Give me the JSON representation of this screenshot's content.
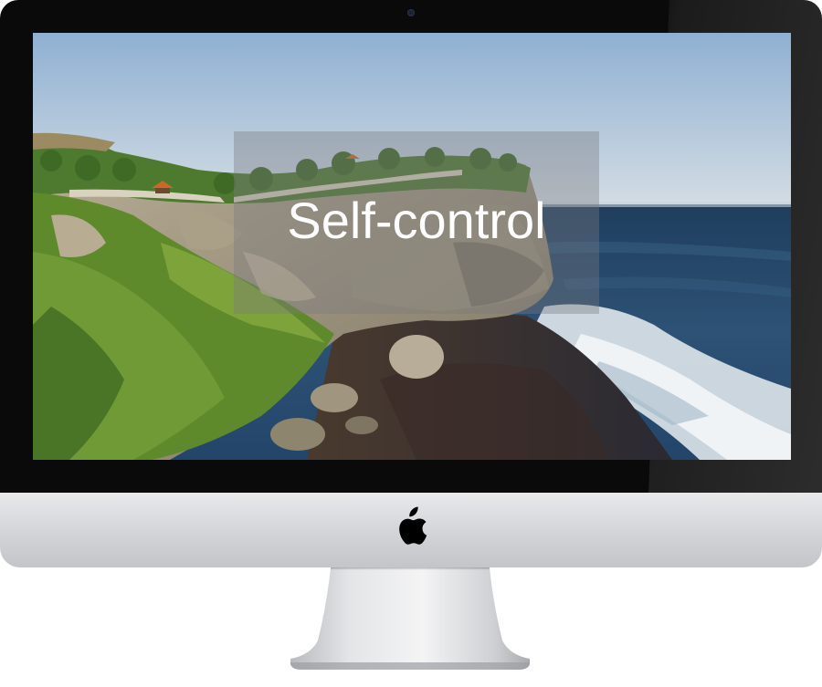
{
  "screen": {
    "title": "Self-control"
  },
  "device": {
    "logo_icon": "apple-logo-icon",
    "camera_icon": "webcam-icon"
  },
  "colors": {
    "bezel": "#0a0a0a",
    "chin": "#d2d4d8",
    "sky": "#9bb6d3",
    "sea": "#284866",
    "title_text": "#ffffff"
  }
}
